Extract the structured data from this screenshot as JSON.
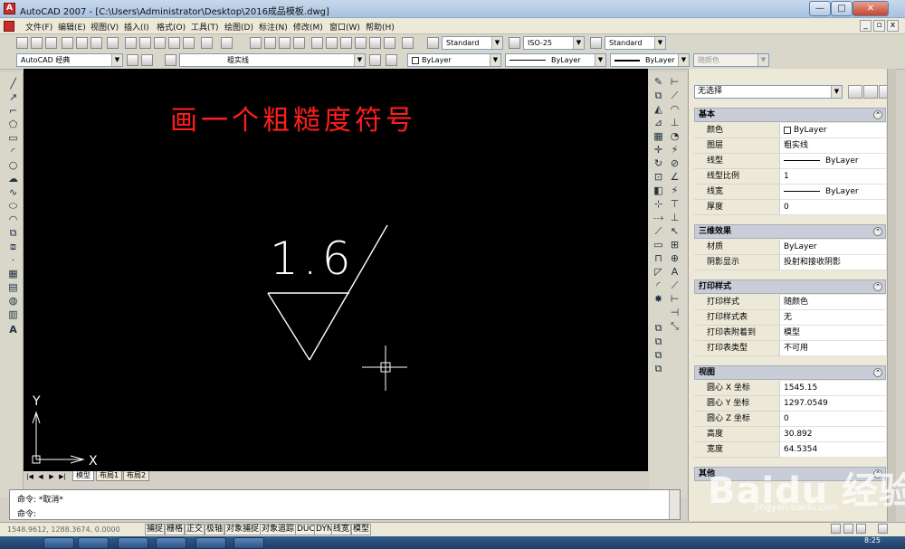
{
  "window": {
    "title": "AutoCAD 2007 - [C:\\Users\\Administrator\\Desktop\\2016成品模板.dwg]",
    "min_label": "—",
    "max_label": "□",
    "close_label": "✕",
    "app_icon": "A"
  },
  "menu": {
    "items": [
      "文件(F)",
      "编辑(E)",
      "视图(V)",
      "插入(I)",
      "格式(O)",
      "工具(T)",
      "绘图(D)",
      "标注(N)",
      "修改(M)",
      "窗口(W)",
      "帮助(H)"
    ],
    "doc_min": "_",
    "doc_restore": "▫",
    "doc_close": "x"
  },
  "toolbar": {
    "text_style": "Standard",
    "dim_style": "ISO-25",
    "table_style": "Standard",
    "workspace": "AutoCAD 经典",
    "layer": "粗实线",
    "color": "ByLayer",
    "linetype": "ByLayer",
    "lineweight": "ByLayer",
    "plotstyle": "随颜色"
  },
  "drawing": {
    "heading": "画一个粗糙度符号",
    "value_text": "1.6",
    "y_axis": "Y",
    "x_axis": "X"
  },
  "layout_tabs": [
    "模型",
    "布局1",
    "布局2"
  ],
  "command": {
    "line1": "命令: *取消*",
    "line2": "命令:"
  },
  "status": {
    "coords": "1548.9612,  1288.3674,  0.0000",
    "buttons": [
      "捕捉",
      "栅格",
      "正交",
      "极轴",
      "对象捕捉",
      "对象追踪",
      "DUCS",
      "DYN",
      "线宽",
      "模型"
    ]
  },
  "properties": {
    "selection": "无选择",
    "sections": [
      {
        "title": "基本",
        "rows": [
          {
            "k": "颜色",
            "v": "ByLayer"
          },
          {
            "k": "图层",
            "v": "粗实线"
          },
          {
            "k": "线型",
            "v": "ByLayer"
          },
          {
            "k": "线型比例",
            "v": "1"
          },
          {
            "k": "线宽",
            "v": "ByLayer"
          },
          {
            "k": "厚度",
            "v": "0"
          }
        ]
      },
      {
        "title": "三维效果",
        "rows": [
          {
            "k": "材质",
            "v": "ByLayer"
          },
          {
            "k": "阴影显示",
            "v": "投射和接收阴影"
          }
        ]
      },
      {
        "title": "打印样式",
        "rows": [
          {
            "k": "打印样式",
            "v": "随颜色"
          },
          {
            "k": "打印样式表",
            "v": "无"
          },
          {
            "k": "打印表附着到",
            "v": "模型"
          },
          {
            "k": "打印表类型",
            "v": "不可用"
          }
        ]
      },
      {
        "title": "视图",
        "rows": [
          {
            "k": "圆心 X 坐标",
            "v": "1545.15"
          },
          {
            "k": "圆心 Y 坐标",
            "v": "1297.0549"
          },
          {
            "k": "圆心 Z 坐标",
            "v": "0"
          },
          {
            "k": "高度",
            "v": "30.892"
          },
          {
            "k": "宽度",
            "v": "64.5354"
          }
        ]
      },
      {
        "title": "其他",
        "rows": []
      }
    ]
  },
  "taskbar": {
    "clock": "8:25"
  },
  "watermark": {
    "brand": "Baidu 经验",
    "url": "jingyan.baidu.com"
  }
}
